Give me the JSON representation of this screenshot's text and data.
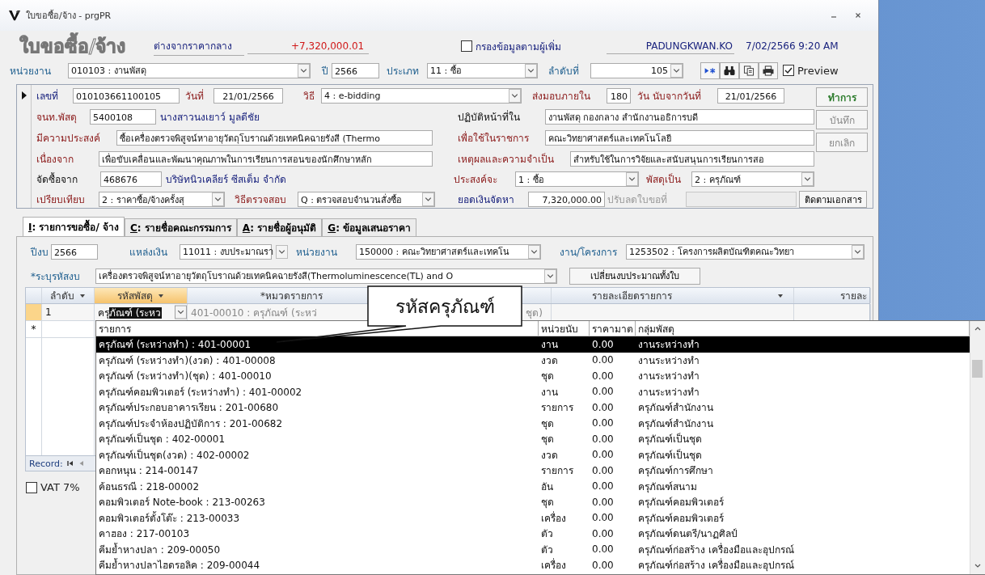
{
  "window": {
    "title": "ใบขอซื้อ/จ้าง - prgPR"
  },
  "header": {
    "title": "ใบขอซื้อ/จ้าง",
    "difference_label": "ต่างจากราคากลาง",
    "difference_value": "+7,320,000.01",
    "filter": {
      "label": "กรองข้อมูลตามผู้เพิ่ม",
      "checked": false
    },
    "user": "PADUNGKWAN.KO",
    "datetime": "7/02/2566 9:20 AM"
  },
  "toolbar": {
    "items": [
      {
        "kind": "label",
        "text": "หน่วยงาน"
      },
      {
        "kind": "combo",
        "value": "010103 : งานพัสดุ"
      },
      {
        "kind": "label",
        "text": "ปี"
      },
      {
        "kind": "input",
        "value": "2566"
      },
      {
        "kind": "label",
        "text": "ประเภท"
      },
      {
        "kind": "combo",
        "value": "11 : ซื้อ"
      },
      {
        "kind": "label",
        "text": "ลำดับที่"
      },
      {
        "kind": "combo",
        "value": "105"
      }
    ],
    "preview": {
      "label": "Preview",
      "checked": true
    }
  },
  "form": {
    "rows": [
      {
        "items": [
          {
            "kind": "label",
            "text": "เลขที่"
          },
          {
            "kind": "input",
            "value": "010103661100105",
            "disabled": false
          },
          {
            "kind": "label",
            "text": "วันที่"
          },
          {
            "kind": "input",
            "value": "21/01/2566",
            "disabled": false
          },
          {
            "kind": "label",
            "text": "วิธี"
          },
          {
            "kind": "combo",
            "value": "4 : e-bidding",
            "disabled": false
          },
          {
            "kind": "label",
            "text": "ส่งมอบภายใน"
          },
          {
            "kind": "input",
            "value": "180",
            "disabled": false
          },
          {
            "kind": "label",
            "text": "วัน นับจากวันที่"
          },
          {
            "kind": "input",
            "value": "21/01/2566",
            "disabled": false
          }
        ]
      },
      {
        "items": [
          {
            "kind": "label",
            "text": "จนท.พัสดุ"
          },
          {
            "kind": "input",
            "value": "5400108",
            "disabled": false
          },
          {
            "kind": "text",
            "text": "นางสาวนงเยาว์ มูลดีชัย"
          },
          {
            "kind": "label",
            "text": "ปฏิบัติหน้าที่ใน"
          },
          {
            "kind": "input",
            "value": "งานพัสดุ กองกลาง สำนักงานอธิการบดี",
            "disabled": false
          }
        ]
      },
      {
        "items": [
          {
            "kind": "label",
            "text": "มีความประสงค์"
          },
          {
            "kind": "input",
            "value": "ซื้อเครื่องตรวจพิสูจน์หาอายุวัตถุโบราณด้วยเทคนิคฉายรังสี (Thermo",
            "disabled": false
          },
          {
            "kind": "label",
            "text": "เพื่อใช้ในราชการ"
          },
          {
            "kind": "input",
            "value": "คณะวิทยาศาสตร์และเทคโนโลยี",
            "disabled": false
          }
        ]
      },
      {
        "items": [
          {
            "kind": "label",
            "text": "เนื่องจาก"
          },
          {
            "kind": "input",
            "value": "เพื่อขับเคลื่อนและพัฒนาคุณภาพในการเรียนการสอนของนักศึกษาหลัก",
            "disabled": false
          },
          {
            "kind": "label",
            "text": "เหตุผลและความจำเป็น"
          },
          {
            "kind": "input",
            "value": "สำหรับใช้ในการวิจัยและสนับสนุนการเรียนการสอ",
            "disabled": false
          }
        ]
      },
      {
        "items": [
          {
            "kind": "label",
            "text": "จัดซื้อจาก"
          },
          {
            "kind": "input",
            "value": "468676",
            "disabled": false
          },
          {
            "kind": "text",
            "text": "บริษัทนิวเคลียร์ ซีสเต็ม จำกัด"
          },
          {
            "kind": "label",
            "text": "ประสงค์จะ"
          },
          {
            "kind": "combo",
            "value": "1 : ซื้อ",
            "disabled": false
          },
          {
            "kind": "label",
            "text": "พัสดุเป็น"
          },
          {
            "kind": "combo",
            "value": "2 : ครุภัณฑ์",
            "disabled": false
          }
        ]
      },
      {
        "items": [
          {
            "kind": "label",
            "text": "เปรียบเทียบ"
          },
          {
            "kind": "combo",
            "value": "2 : ราคาซื้อ/จ้างครั้งสุ",
            "disabled": false
          },
          {
            "kind": "label",
            "text": "วิธีตรวจสอบ"
          },
          {
            "kind": "combo",
            "value": "Q : ตรวจสอบจำนวนสั่งซื้อ",
            "disabled": false
          },
          {
            "kind": "label",
            "text": "ยอดเงินจัดหา"
          },
          {
            "kind": "input",
            "value": "7,320,000.00",
            "disabled": false
          },
          {
            "kind": "label",
            "text": "ปรับลดใบขอที่"
          },
          {
            "kind": "input",
            "disabled": true
          },
          {
            "kind": "button",
            "label": "ติดตามเอกสาร"
          }
        ]
      }
    ],
    "side_buttons": [
      {
        "label": "ทำการ",
        "disabled": false
      },
      {
        "label": "บันทึก",
        "disabled": true
      },
      {
        "label": "ยกเลิก",
        "disabled": true
      }
    ]
  },
  "tabs": [
    {
      "key": "I",
      "label": ": รายการขอซื้อ/ จ้าง",
      "selected": true
    },
    {
      "key": "C",
      "label": ": รายชื่อคณะกรรมการ",
      "selected": false
    },
    {
      "key": "A",
      "label": ": รายชื่อผู้อนุมัติ",
      "selected": false
    },
    {
      "key": "G",
      "label": ": ข้อมูลเสนอราคา",
      "selected": false
    }
  ],
  "filters": {
    "rows": [
      {
        "items": [
          {
            "kind": "label",
            "text": "ปีงบ"
          },
          {
            "kind": "input",
            "value": "2566"
          },
          {
            "kind": "label",
            "text": "แหล่งเงิน"
          },
          {
            "kind": "combo",
            "value": "11011 : งบประมาณรา"
          },
          {
            "kind": "label",
            "text": "หน่วยงาน"
          },
          {
            "kind": "combo",
            "value": "150000 : คณะวิทยาศาสตร์และเทคโน"
          },
          {
            "kind": "label",
            "text": "งาน/โครงการ"
          },
          {
            "kind": "combo",
            "value": "1253502 : โครงการผลิตบัณฑิตคณะวิทยา"
          }
        ]
      },
      {
        "items": [
          {
            "kind": "label",
            "text": "*ระบุรหัสงบ"
          },
          {
            "kind": "combo",
            "value": "เครื่องตรวจพิสูจน์หาอายุวัตถุโบราณด้วยเทคนิคฉายรังสี(Thermoluminescence(TL) and O"
          },
          {
            "kind": "button",
            "label": "เปลี่ยนงบประมาณทั้งใบ"
          }
        ]
      }
    ]
  },
  "datasheet": {
    "columns": [
      {
        "label": "ลำดับ",
        "menu": true,
        "selected": false
      },
      {
        "label": "รหัสพัสดุ",
        "menu": true,
        "selected": true
      },
      {
        "label": "*หมวดรายการ",
        "menu": false,
        "selected": false
      },
      {
        "label": "รายละเอียดรายการ",
        "menu": true,
        "selected": false
      },
      {
        "label": "รายละ",
        "menu": false,
        "selected": false
      }
    ],
    "row": {
      "number": "1",
      "code_typed": "ครุ",
      "code_selected": "ภัณฑ์ (ระหว",
      "category": [
        "401-00010 : ครุภัณฑ์ (ระหว่",
        "ชุด)"
      ]
    },
    "new_row_marker": "*",
    "record_label": "Record:"
  },
  "vat": {
    "label": "VAT 7%",
    "checked": false
  },
  "callout": {
    "text": "รหัสครุภัณฑ์"
  },
  "dropdown": {
    "columns": [
      "รายการ",
      "หน่วยนับ",
      "ราคามาต",
      "กลุ่มพัสดุ"
    ],
    "rows": [
      {
        "item": "ครุภัณฑ์ (ระหว่างทำ) : 401-00001",
        "unit": "งาน",
        "price": "0.00",
        "group": "งานระหว่างทำ",
        "selected": true
      },
      {
        "item": "ครุภัณฑ์ (ระหว่างทำ)(งวด) : 401-00008",
        "unit": "งวด",
        "price": "0.00",
        "group": "งานระหว่างทำ",
        "selected": false
      },
      {
        "item": "ครุภัณฑ์ (ระหว่างทำ)(ชุด) : 401-00010",
        "unit": "ชุด",
        "price": "0.00",
        "group": "งานระหว่างทำ",
        "selected": false
      },
      {
        "item": "ครุภัณฑ์คอมพิวเตอร์ (ระหว่างทำ) : 401-00002",
        "unit": "งาน",
        "price": "0.00",
        "group": "งานระหว่างทำ",
        "selected": false
      },
      {
        "item": "ครุภัณฑ์ประกอบอาคารเรียน : 201-00680",
        "unit": "รายการ",
        "price": "0.00",
        "group": "ครุภัณฑ์สำนักงาน",
        "selected": false
      },
      {
        "item": "ครุภัณฑ์ประจำห้องปฏิบัติการ : 201-00682",
        "unit": "ชุด",
        "price": "0.00",
        "group": "ครุภัณฑ์สำนักงาน",
        "selected": false
      },
      {
        "item": "ครุภัณฑ์เป็นชุด : 402-00001",
        "unit": "ชุด",
        "price": "0.00",
        "group": "ครุภัณฑ์เป็นชุด",
        "selected": false
      },
      {
        "item": "ครุภัณฑ์เป็นชุด(งวด) : 402-00002",
        "unit": "งวด",
        "price": "0.00",
        "group": "ครุภัณฑ์เป็นชุด",
        "selected": false
      },
      {
        "item": "คอกหนุน : 214-00147",
        "unit": "รายการ",
        "price": "0.00",
        "group": "ครุภัณฑ์การศึกษา",
        "selected": false
      },
      {
        "item": "ค้อนธรณี : 218-00002",
        "unit": "อัน",
        "price": "0.00",
        "group": "ครุภัณฑ์สนาม",
        "selected": false
      },
      {
        "item": "คอมพิวเตอร์ Note-book : 213-00263",
        "unit": "ชุด",
        "price": "0.00",
        "group": "ครุภัณฑ์คอมพิวเตอร์",
        "selected": false
      },
      {
        "item": "คอมพิวเตอร์ตั้งโต๊ะ : 213-00033",
        "unit": "เครื่อง",
        "price": "0.00",
        "group": "ครุภัณฑ์คอมพิวเตอร์",
        "selected": false
      },
      {
        "item": "คาฮอง : 217-00103",
        "unit": "ตัว",
        "price": "0.00",
        "group": "ครุภัณฑ์ดนตรี/นาฏศิลป์",
        "selected": false
      },
      {
        "item": "คีมย้ำหางปลา : 209-00050",
        "unit": "ตัว",
        "price": "0.00",
        "group": "ครุภัณฑ์ก่อสร้าง เครื่องมือและอุปกรณ์",
        "selected": false
      },
      {
        "item": "คีมย้ำหางปลาไฮดรอลิค : 209-00044",
        "unit": "เครื่อง",
        "price": "0.00",
        "group": "ครุภัณฑ์ก่อสร้าง เครื่องมือและอุปกรณ์",
        "selected": false
      }
    ]
  }
}
